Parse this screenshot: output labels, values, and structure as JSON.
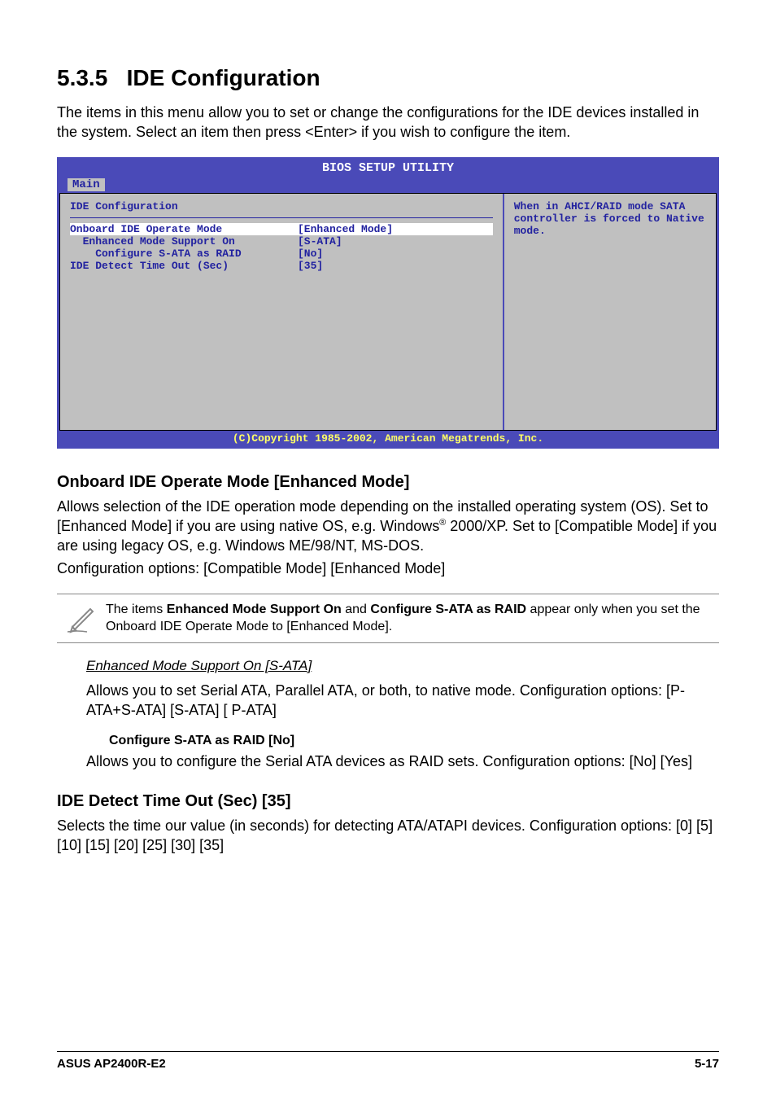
{
  "title_num": "5.3.5",
  "title_text": "IDE Configuration",
  "intro": "The items in this menu allow you to set or change the configurations for the IDE devices installed in the system. Select an item then press <Enter> if you wish to configure the item.",
  "bios": {
    "title": "BIOS SETUP UTILITY",
    "tab": "Main",
    "panel_title": "IDE Configuration",
    "rows": [
      {
        "label": "Onboard IDE Operate Mode",
        "value": "[Enhanced Mode]",
        "indent": 0,
        "highlight": true
      },
      {
        "label": "Enhanced Mode Support On",
        "value": "[S-ATA]",
        "indent": 1,
        "highlight": false
      },
      {
        "label": "Configure S-ATA as RAID",
        "value": "[No]",
        "indent": 2,
        "highlight": false
      },
      {
        "label": "IDE Detect Time Out (Sec)",
        "value": "[35]",
        "indent": 0,
        "highlight": false
      }
    ],
    "help": "When in AHCI/RAID mode SATA controller is forced to Native mode.",
    "copyright": "(C)Copyright 1985-2002, American Megatrends, Inc."
  },
  "onboard": {
    "heading": "Onboard IDE Operate Mode [Enhanced Mode]",
    "p1a": "Allows selection of the IDE operation mode depending on the installed operating system (OS). Set to [Enhanced Mode] if you are using native OS, e.g. Windows",
    "p1b": " 2000/XP. Set to [Compatible Mode] if you are using legacy OS, e.g. Windows ME/98/NT, MS-DOS.",
    "p2": "Configuration options: [Compatible Mode] [Enhanced Mode]"
  },
  "note": {
    "t1": "The items ",
    "b1": "Enhanced Mode Support On",
    "t2": " and ",
    "b2": "Configure S-ATA as RAID",
    "t3": " appear only when you set the Onboard IDE Operate Mode to [Enhanced Mode]."
  },
  "enhanced": {
    "heading": "Enhanced Mode Support On [S-ATA]",
    "p1": "Allows you to set Serial ATA, Parallel ATA, or both, to native mode. Configuration options: [P-ATA+S-ATA] [S-ATA] [ P-ATA]"
  },
  "configure": {
    "heading": "Configure S-ATA as RAID [No]",
    "p1": "Allows you to configure the Serial ATA devices as RAID sets. Configuration options: [No] [Yes]"
  },
  "ide_detect": {
    "heading": "IDE Detect Time Out (Sec) [35]",
    "p1": "Selects the time our value (in seconds) for detecting ATA/ATAPI devices. Configuration options: [0] [5] [10] [15] [20] [25] [30] [35]"
  },
  "footer": {
    "left": "ASUS AP2400R-E2",
    "right": "5-17"
  }
}
